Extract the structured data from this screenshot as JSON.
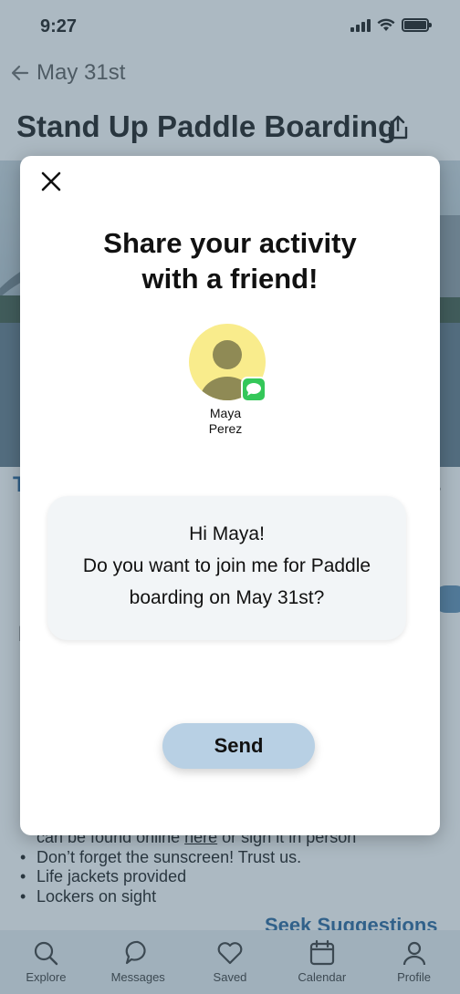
{
  "status_bar": {
    "time": "9:27"
  },
  "nav": {
    "back_label": "May 31st"
  },
  "page": {
    "title": "Stand Up Paddle Boarding"
  },
  "background_content": {
    "bullets": [
      {
        "prefix": "can be found online ",
        "link": "here",
        "suffix": " or sign it in person"
      },
      {
        "text": "Don’t forget the sunscreen! Trust us."
      },
      {
        "text": "Life jackets provided"
      },
      {
        "text": "Lockers on sight"
      }
    ],
    "seek_suggestions": "Seek Suggestions"
  },
  "modal": {
    "title_line1": "Share your activity",
    "title_line2": "with a friend!",
    "contact": {
      "first_name": "Maya",
      "last_name": "Perez"
    },
    "message": {
      "line1": "Hi Maya!",
      "line2": "Do you want to join me for Paddle",
      "line3": "boarding on May 31st?"
    },
    "send_label": "Send"
  },
  "tab_bar": {
    "items": [
      {
        "label": "Explore",
        "icon": "search-icon"
      },
      {
        "label": "Messages",
        "icon": "chat-icon"
      },
      {
        "label": "Saved",
        "icon": "heart-icon"
      },
      {
        "label": "Calendar",
        "icon": "calendar-icon"
      },
      {
        "label": "Profile",
        "icon": "person-icon"
      }
    ]
  },
  "colors": {
    "accent": "#1f5f99",
    "send_button": "#b8d0e4",
    "avatar_bg": "#f9ec8c",
    "imessage_green": "#34c759",
    "overlay": "#46647880"
  }
}
